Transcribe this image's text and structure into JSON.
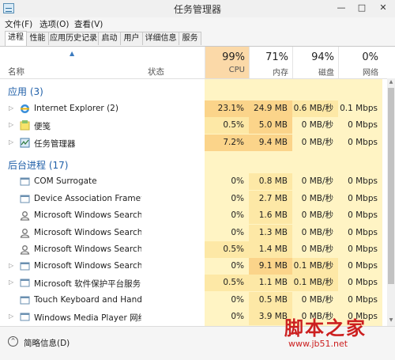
{
  "window": {
    "title": "任务管理器",
    "minimize": "—",
    "maximize": "□",
    "close": "✕"
  },
  "menu": [
    "文件(F)",
    "选项(O)",
    "查看(V)"
  ],
  "tabs": [
    "进程",
    "性能",
    "应用历史记录",
    "启动",
    "用户",
    "详细信息",
    "服务"
  ],
  "active_tab": 0,
  "columns": {
    "name": "名称",
    "status": "状态",
    "cpu": {
      "pct": "99%",
      "label": "CPU"
    },
    "mem": {
      "pct": "71%",
      "label": "内存"
    },
    "disk": {
      "pct": "94%",
      "label": "磁盘"
    },
    "net": {
      "pct": "0%",
      "label": "网络"
    }
  },
  "sections": [
    {
      "title": "应用 (3)"
    },
    {
      "title": "后台进程 (17)"
    }
  ],
  "rows": [
    {
      "name": "Internet Explorer (2)",
      "cpu": "23.1%",
      "mem": "24.9 MB",
      "disk": "0.6 MB/秒",
      "net": "0.1 Mbps",
      "expand": "▷",
      "icon": "ie-icon"
    },
    {
      "name": "便笺",
      "cpu": "0.5%",
      "mem": "5.0 MB",
      "disk": "0 MB/秒",
      "net": "0 Mbps",
      "expand": "▷",
      "icon": "sticky-notes-icon"
    },
    {
      "name": "任务管理器",
      "cpu": "7.2%",
      "mem": "9.4 MB",
      "disk": "0 MB/秒",
      "net": "0 Mbps",
      "expand": "▷",
      "icon": "task-manager-icon"
    },
    {
      "name": "COM Surrogate",
      "cpu": "0%",
      "mem": "0.8 MB",
      "disk": "0 MB/秒",
      "net": "0 Mbps",
      "expand": "",
      "icon": "process-icon"
    },
    {
      "name": "Device Association Framewo...",
      "cpu": "0%",
      "mem": "2.7 MB",
      "disk": "0 MB/秒",
      "net": "0 Mbps",
      "expand": "",
      "icon": "process-icon"
    },
    {
      "name": "Microsoft Windows Search Fi...",
      "cpu": "0%",
      "mem": "1.6 MB",
      "disk": "0 MB/秒",
      "net": "0 Mbps",
      "expand": "",
      "icon": "search-user-icon"
    },
    {
      "name": "Microsoft Windows Search P...",
      "cpu": "0%",
      "mem": "1.3 MB",
      "disk": "0 MB/秒",
      "net": "0 Mbps",
      "expand": "",
      "icon": "search-user-icon"
    },
    {
      "name": "Microsoft Windows Search P...",
      "cpu": "0.5%",
      "mem": "1.4 MB",
      "disk": "0 MB/秒",
      "net": "0 Mbps",
      "expand": "",
      "icon": "search-user-icon"
    },
    {
      "name": "Microsoft Windows Search ...",
      "cpu": "0%",
      "mem": "9.1 MB",
      "disk": "0.1 MB/秒",
      "net": "0 Mbps",
      "expand": "▷",
      "icon": "process-icon"
    },
    {
      "name": "Microsoft 软件保护平台服务",
      "cpu": "0.5%",
      "mem": "1.1 MB",
      "disk": "0.1 MB/秒",
      "net": "0 Mbps",
      "expand": "▷",
      "icon": "process-icon"
    },
    {
      "name": "Touch Keyboard and Handw...",
      "cpu": "0%",
      "mem": "0.5 MB",
      "disk": "0 MB/秒",
      "net": "0 Mbps",
      "expand": "",
      "icon": "process-icon"
    },
    {
      "name": "Windows Media Player 网络...",
      "cpu": "0%",
      "mem": "3.9 MB",
      "disk": "0 MB/秒",
      "net": "0 Mbps",
      "expand": "▷",
      "icon": "process-icon"
    }
  ],
  "footer": {
    "label": "简略信息(D)",
    "icon": "^"
  },
  "watermark": {
    "text": "脚本之家",
    "url": "www.jb51.net"
  },
  "colors": {
    "cpu_header": "#fbd9a8",
    "heat_low": "#fff4c4",
    "heat_mid": "#fde8a6",
    "heat_high": "#fbd48a",
    "section": "#1f5fa8"
  }
}
